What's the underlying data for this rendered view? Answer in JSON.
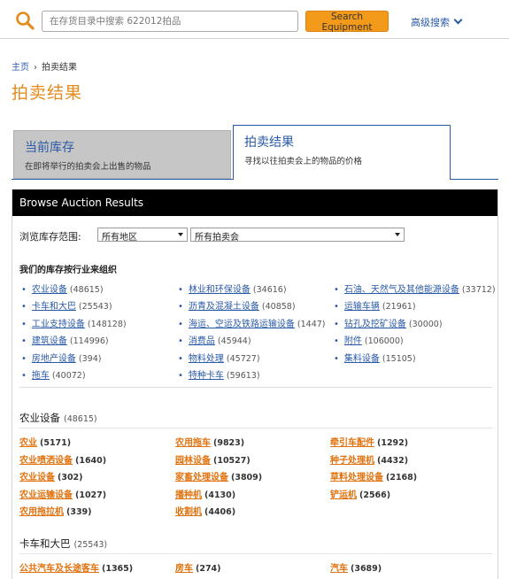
{
  "search": {
    "placeholder": "在存货目录中搜索 622012拍品",
    "button_label": "Search Equipment",
    "advanced_label": "高级搜索"
  },
  "breadcrumb": {
    "home": "主页",
    "separator": "›",
    "current": "拍卖结果"
  },
  "page_title": "拍卖结果",
  "tabs": [
    {
      "title": "当前库存",
      "subtitle": "在即将举行的拍卖会上出售的物品"
    },
    {
      "title": "拍卖结果",
      "subtitle": "寻找以往拍卖会上的物品的价格"
    }
  ],
  "panel": {
    "header": "Browse Auction Results",
    "filter_label": "浏览库存范围:",
    "region_select": "所有地区",
    "auction_select": "所有拍卖会",
    "industry_label": "我们的库存按行业来组织"
  },
  "industries": {
    "col1": [
      {
        "name": "农业设备",
        "count": "(48615)"
      },
      {
        "name": "卡车和大巴",
        "count": "(25543)"
      },
      {
        "name": "工业支持设备",
        "count": "(148128)"
      },
      {
        "name": "建筑设备",
        "count": "(114996)"
      },
      {
        "name": "房地产设备",
        "count": "(394)"
      },
      {
        "name": "拖车",
        "count": "(40072)"
      }
    ],
    "col2": [
      {
        "name": "林业和环保设备",
        "count": "(34616)"
      },
      {
        "name": "沥青及混凝土设备",
        "count": "(40858)"
      },
      {
        "name": "海运、空运及铁路运输设备",
        "count": "(1447)"
      },
      {
        "name": "消费品",
        "count": "(45944)"
      },
      {
        "name": "物料处理",
        "count": "(45727)"
      },
      {
        "name": "特种卡车",
        "count": "(59613)"
      }
    ],
    "col3": [
      {
        "name": "石油、天然气及其他能源设备",
        "count": "(33712)"
      },
      {
        "name": "运输车辆",
        "count": "(21961)"
      },
      {
        "name": "钻孔及挖矿设备",
        "count": "(30000)"
      },
      {
        "name": "附件",
        "count": "(106000)"
      },
      {
        "name": "集料设备",
        "count": "(15105)"
      }
    ]
  },
  "categories": [
    {
      "title": "农业设备",
      "count": "(48615)",
      "col1": [
        {
          "name": "农业",
          "count": "(5171)"
        },
        {
          "name": "农业喷洒设备",
          "count": "(1640)"
        },
        {
          "name": "农业设备",
          "count": "(302)"
        },
        {
          "name": "农业运输设备",
          "count": "(1027)"
        },
        {
          "name": "农用拖拉机",
          "count": "(339)"
        }
      ],
      "col2": [
        {
          "name": "农用拖车",
          "count": "(9823)"
        },
        {
          "name": "园林设备",
          "count": "(10527)"
        },
        {
          "name": "家畜处理设备",
          "count": "(3809)"
        },
        {
          "name": "播种机",
          "count": "(4130)"
        },
        {
          "name": "收割机",
          "count": "(4406)"
        }
      ],
      "col3": [
        {
          "name": "牵引车配件",
          "count": "(1292)"
        },
        {
          "name": "种子处理机",
          "count": "(4432)"
        },
        {
          "name": "草料处理设备",
          "count": "(2168)"
        },
        {
          "name": "铲运机",
          "count": "(2566)"
        }
      ]
    },
    {
      "title": "卡车和大巴",
      "count": "(25543)",
      "col1": [
        {
          "name": "公共汽车及长途客车",
          "count": "(1365)"
        }
      ],
      "col2": [
        {
          "name": "房车",
          "count": "(274)"
        }
      ],
      "col3": [
        {
          "name": "汽车",
          "count": "(3689)"
        }
      ]
    }
  ]
}
